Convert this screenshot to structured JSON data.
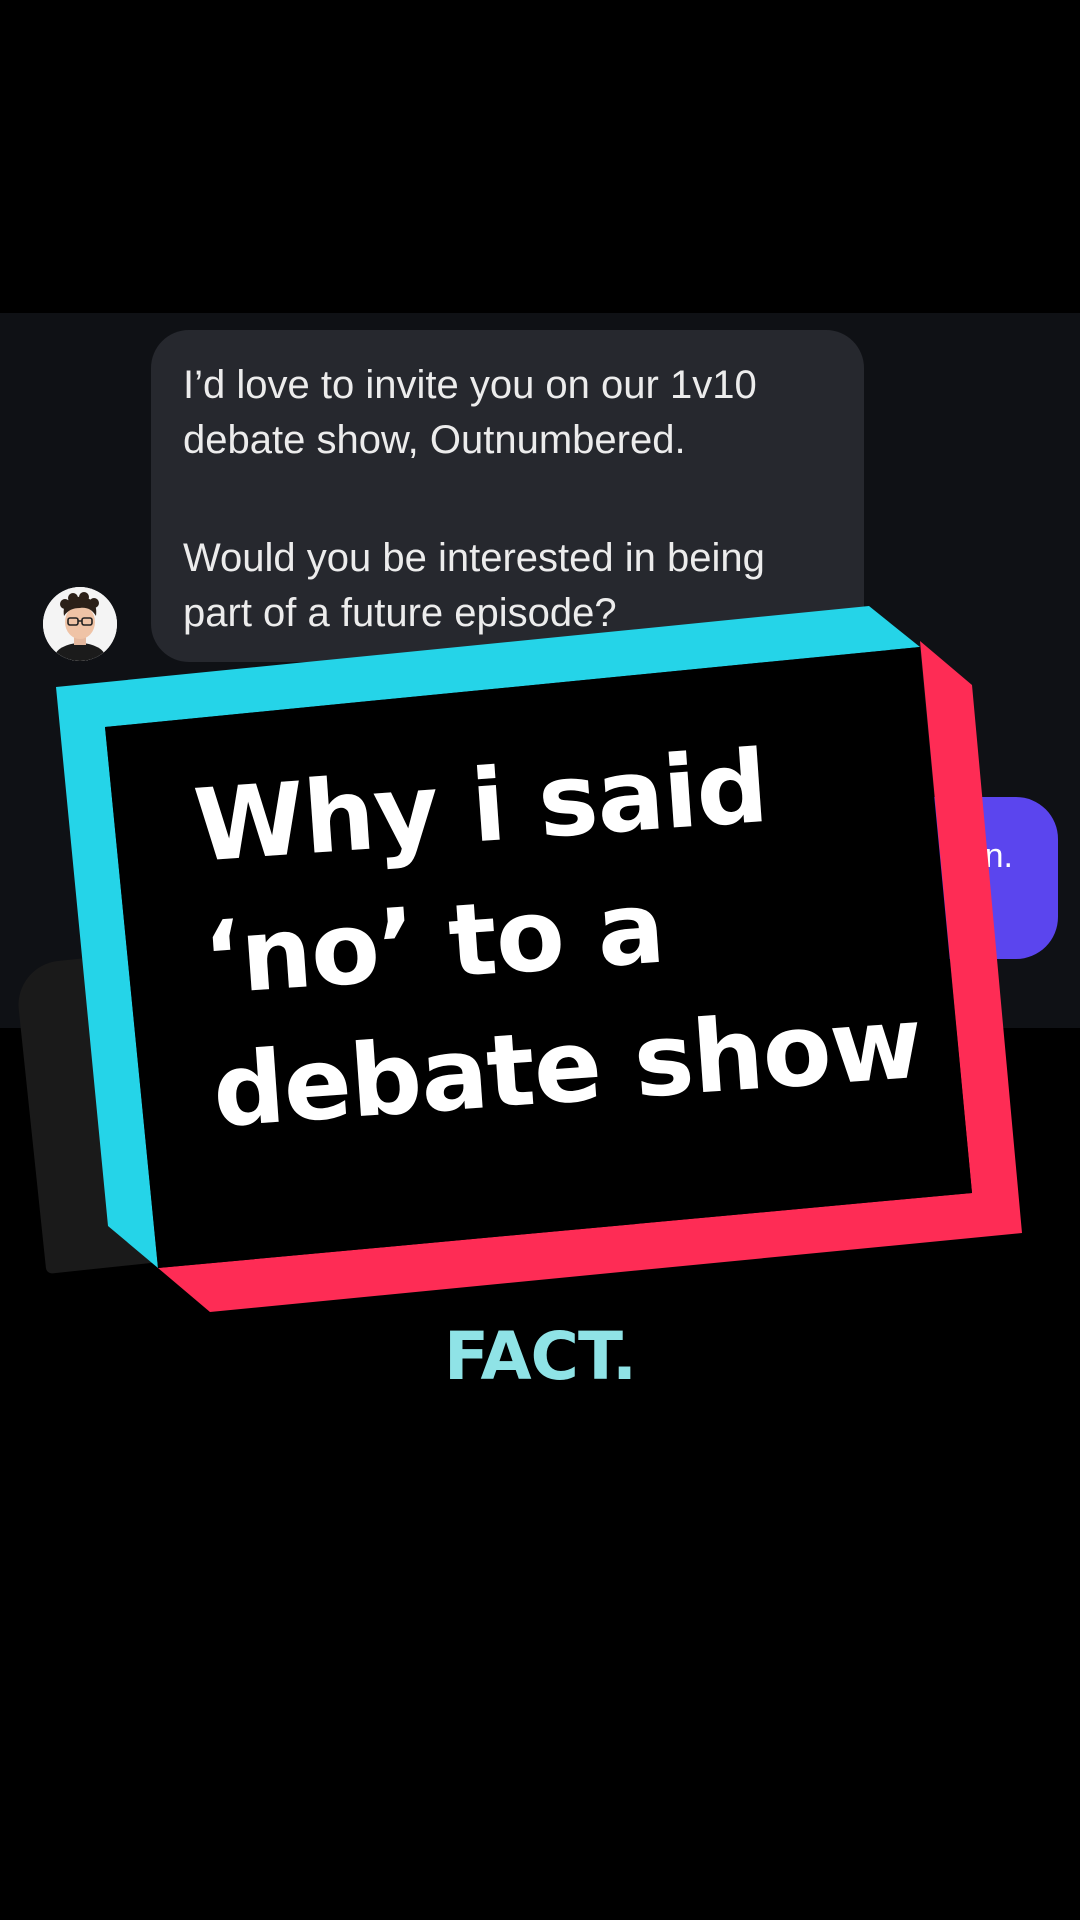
{
  "chat": {
    "incoming_message": {
      "paragraph_1": "I’d love to invite you on our 1v10 debate show, Outnumbered.",
      "paragraph_2": "Would you be interested in being part of a future episode?"
    },
    "outgoing_message_visible_fragment": "n."
  },
  "overlay": {
    "headline_lines": [
      "Why i said",
      "‘no’ to a",
      "debate show"
    ],
    "colors": {
      "card_fill": "#000000",
      "left_top_stripe": "#25d4e8",
      "right_bottom_stripe": "#fe2c55",
      "headline_text": "#ffffff"
    }
  },
  "caption": {
    "text": "FACT."
  },
  "icons": {
    "avatar": "user-avatar-photo"
  },
  "colors": {
    "background": "#000000",
    "chat_panel": "#0f1115",
    "incoming_bubble": "#26282e",
    "outgoing_bubble": "#5b45ee",
    "caption": "#8fe3e6"
  }
}
